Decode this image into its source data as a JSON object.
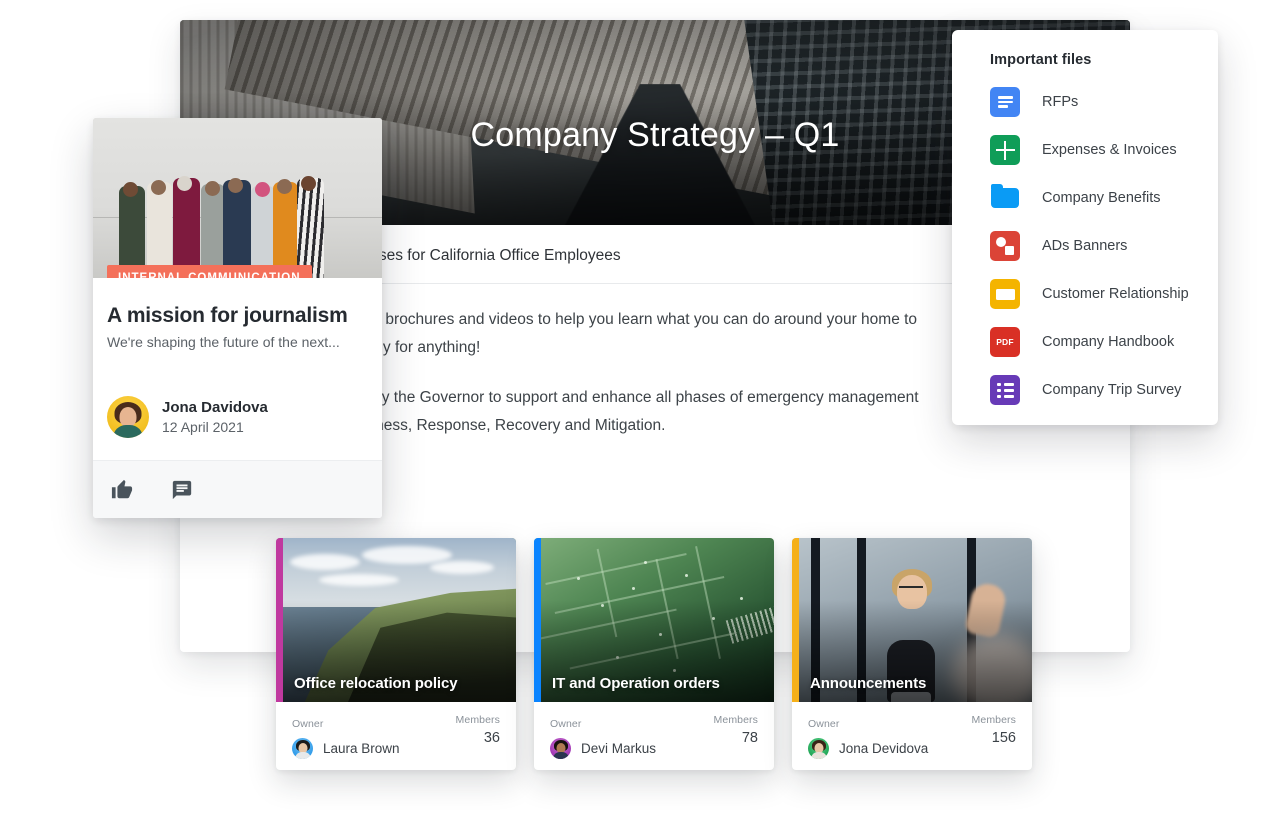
{
  "page": {
    "hero_title": "Company Strategy – Q1",
    "subtitle": "Tips and internal processes for California Office Employees",
    "paragraphs": [
      "Cal OES has tips, tricks, brochures and videos to help you learn what you can do around your home to ensure that you are ready for anything!",
      "Our office is delegated by the Governor to support and enhance all phases of emergency management which include Preparedness, Response, Recovery and Mitigation."
    ]
  },
  "files_panel": {
    "title": "Important files",
    "items": [
      {
        "label": "RFPs",
        "icon": "google-docs-icon",
        "color": "#4285f4"
      },
      {
        "label": "Expenses & Invoices",
        "icon": "google-sheets-icon",
        "color": "#0f9d58"
      },
      {
        "label": "Company Benefits",
        "icon": "folder-icon",
        "color": "#0a9bf5"
      },
      {
        "label": "ADs Banners",
        "icon": "ads-banner-icon",
        "color": "#db4437"
      },
      {
        "label": "Customer Relationship",
        "icon": "crm-card-icon",
        "color": "#f4b400"
      },
      {
        "label": "Company Handbook",
        "icon": "pdf-icon",
        "color": "#d93025",
        "glyph": "PDF"
      },
      {
        "label": "Company Trip Survey",
        "icon": "google-forms-icon",
        "color": "#673ab7"
      }
    ]
  },
  "post_card": {
    "badge": "INTERNAL COMMUNICATION",
    "badge_color": "#f4705a",
    "title": "A mission for journalism",
    "excerpt": "We're shaping the future of the next...",
    "author_name": "Jona Davidova",
    "date": "12 April 2021",
    "actions": [
      {
        "name": "like-button",
        "icon": "thumbs-up-icon"
      },
      {
        "name": "comment-button",
        "icon": "comment-icon"
      }
    ]
  },
  "spaces": {
    "owner_label": "Owner",
    "members_label": "Members",
    "cards": [
      {
        "name": "Office relocation policy",
        "accent": "#c0399f",
        "owner": "Laura Brown",
        "members": "36",
        "image": "coastal-cliffs-photo"
      },
      {
        "name": "IT and Operation orders",
        "accent": "#0a84ff",
        "owner": "Devi Markus",
        "members": "78",
        "image": "green-circuit-board-photo"
      },
      {
        "name": "Announcements",
        "accent": "#f5b01a",
        "owner": "Jona Devidova",
        "members": "156",
        "image": "office-applause-photo"
      }
    ]
  }
}
